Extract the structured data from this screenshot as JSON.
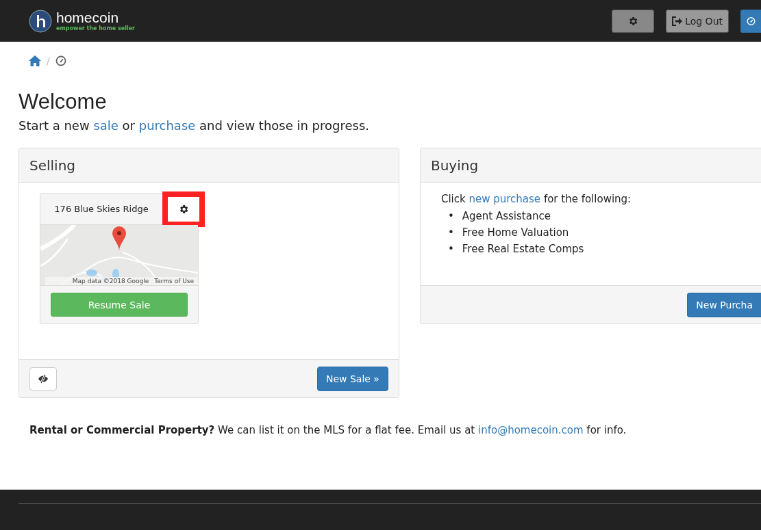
{
  "navbar": {
    "brand": "homecoin",
    "tagline": "empower the home seller",
    "buttons": [
      {
        "kind": "settings"
      },
      {
        "kind": "logout",
        "label": "Log Out"
      },
      {
        "kind": "dashboard"
      }
    ]
  },
  "breadcrumb": [
    {
      "kind": "home"
    },
    {
      "kind": "separator",
      "text": "/"
    },
    {
      "kind": "dashboard"
    }
  ],
  "heading": "Welcome",
  "intro": [
    {
      "kind": "text",
      "text": "Start a new "
    },
    {
      "kind": "link",
      "text": "sale"
    },
    {
      "kind": "text",
      "text": " or "
    },
    {
      "kind": "link",
      "text": "purchase"
    },
    {
      "kind": "text",
      "text": " and view those in progress."
    }
  ],
  "selling": {
    "title": "Selling",
    "properties": [
      {
        "address": "176 Blue Skies Ridge",
        "settings_highlighted": true,
        "map": {
          "kind": "picture",
          "attribution": "Map data ©2018 Google",
          "terms": "Terms of Use"
        },
        "action": "Resume Sale"
      }
    ],
    "hide_button": {
      "kind": "hide"
    },
    "new_button": "New Sale »"
  },
  "buying": {
    "title": "Buying",
    "lead": [
      {
        "kind": "text",
        "text": "Click "
      },
      {
        "kind": "link",
        "text": "new purchase"
      },
      {
        "kind": "text",
        "text": " for the following:"
      }
    ],
    "items": [
      {
        "bullet": "•",
        "text": "Agent Assistance"
      },
      {
        "bullet": "•",
        "text": "Free Home Valuation"
      },
      {
        "bullet": "•",
        "text": "Free Real Estate Comps"
      }
    ],
    "new_button": "New Purcha"
  },
  "notice": [
    {
      "kind": "bold",
      "text": "Rental or Commercial Property?"
    },
    {
      "kind": "text",
      "text": " We can list it on the MLS for a flat fee. Email us at "
    },
    {
      "kind": "link",
      "text": "info@homecoin.com"
    },
    {
      "kind": "text",
      "text": " for info."
    }
  ]
}
